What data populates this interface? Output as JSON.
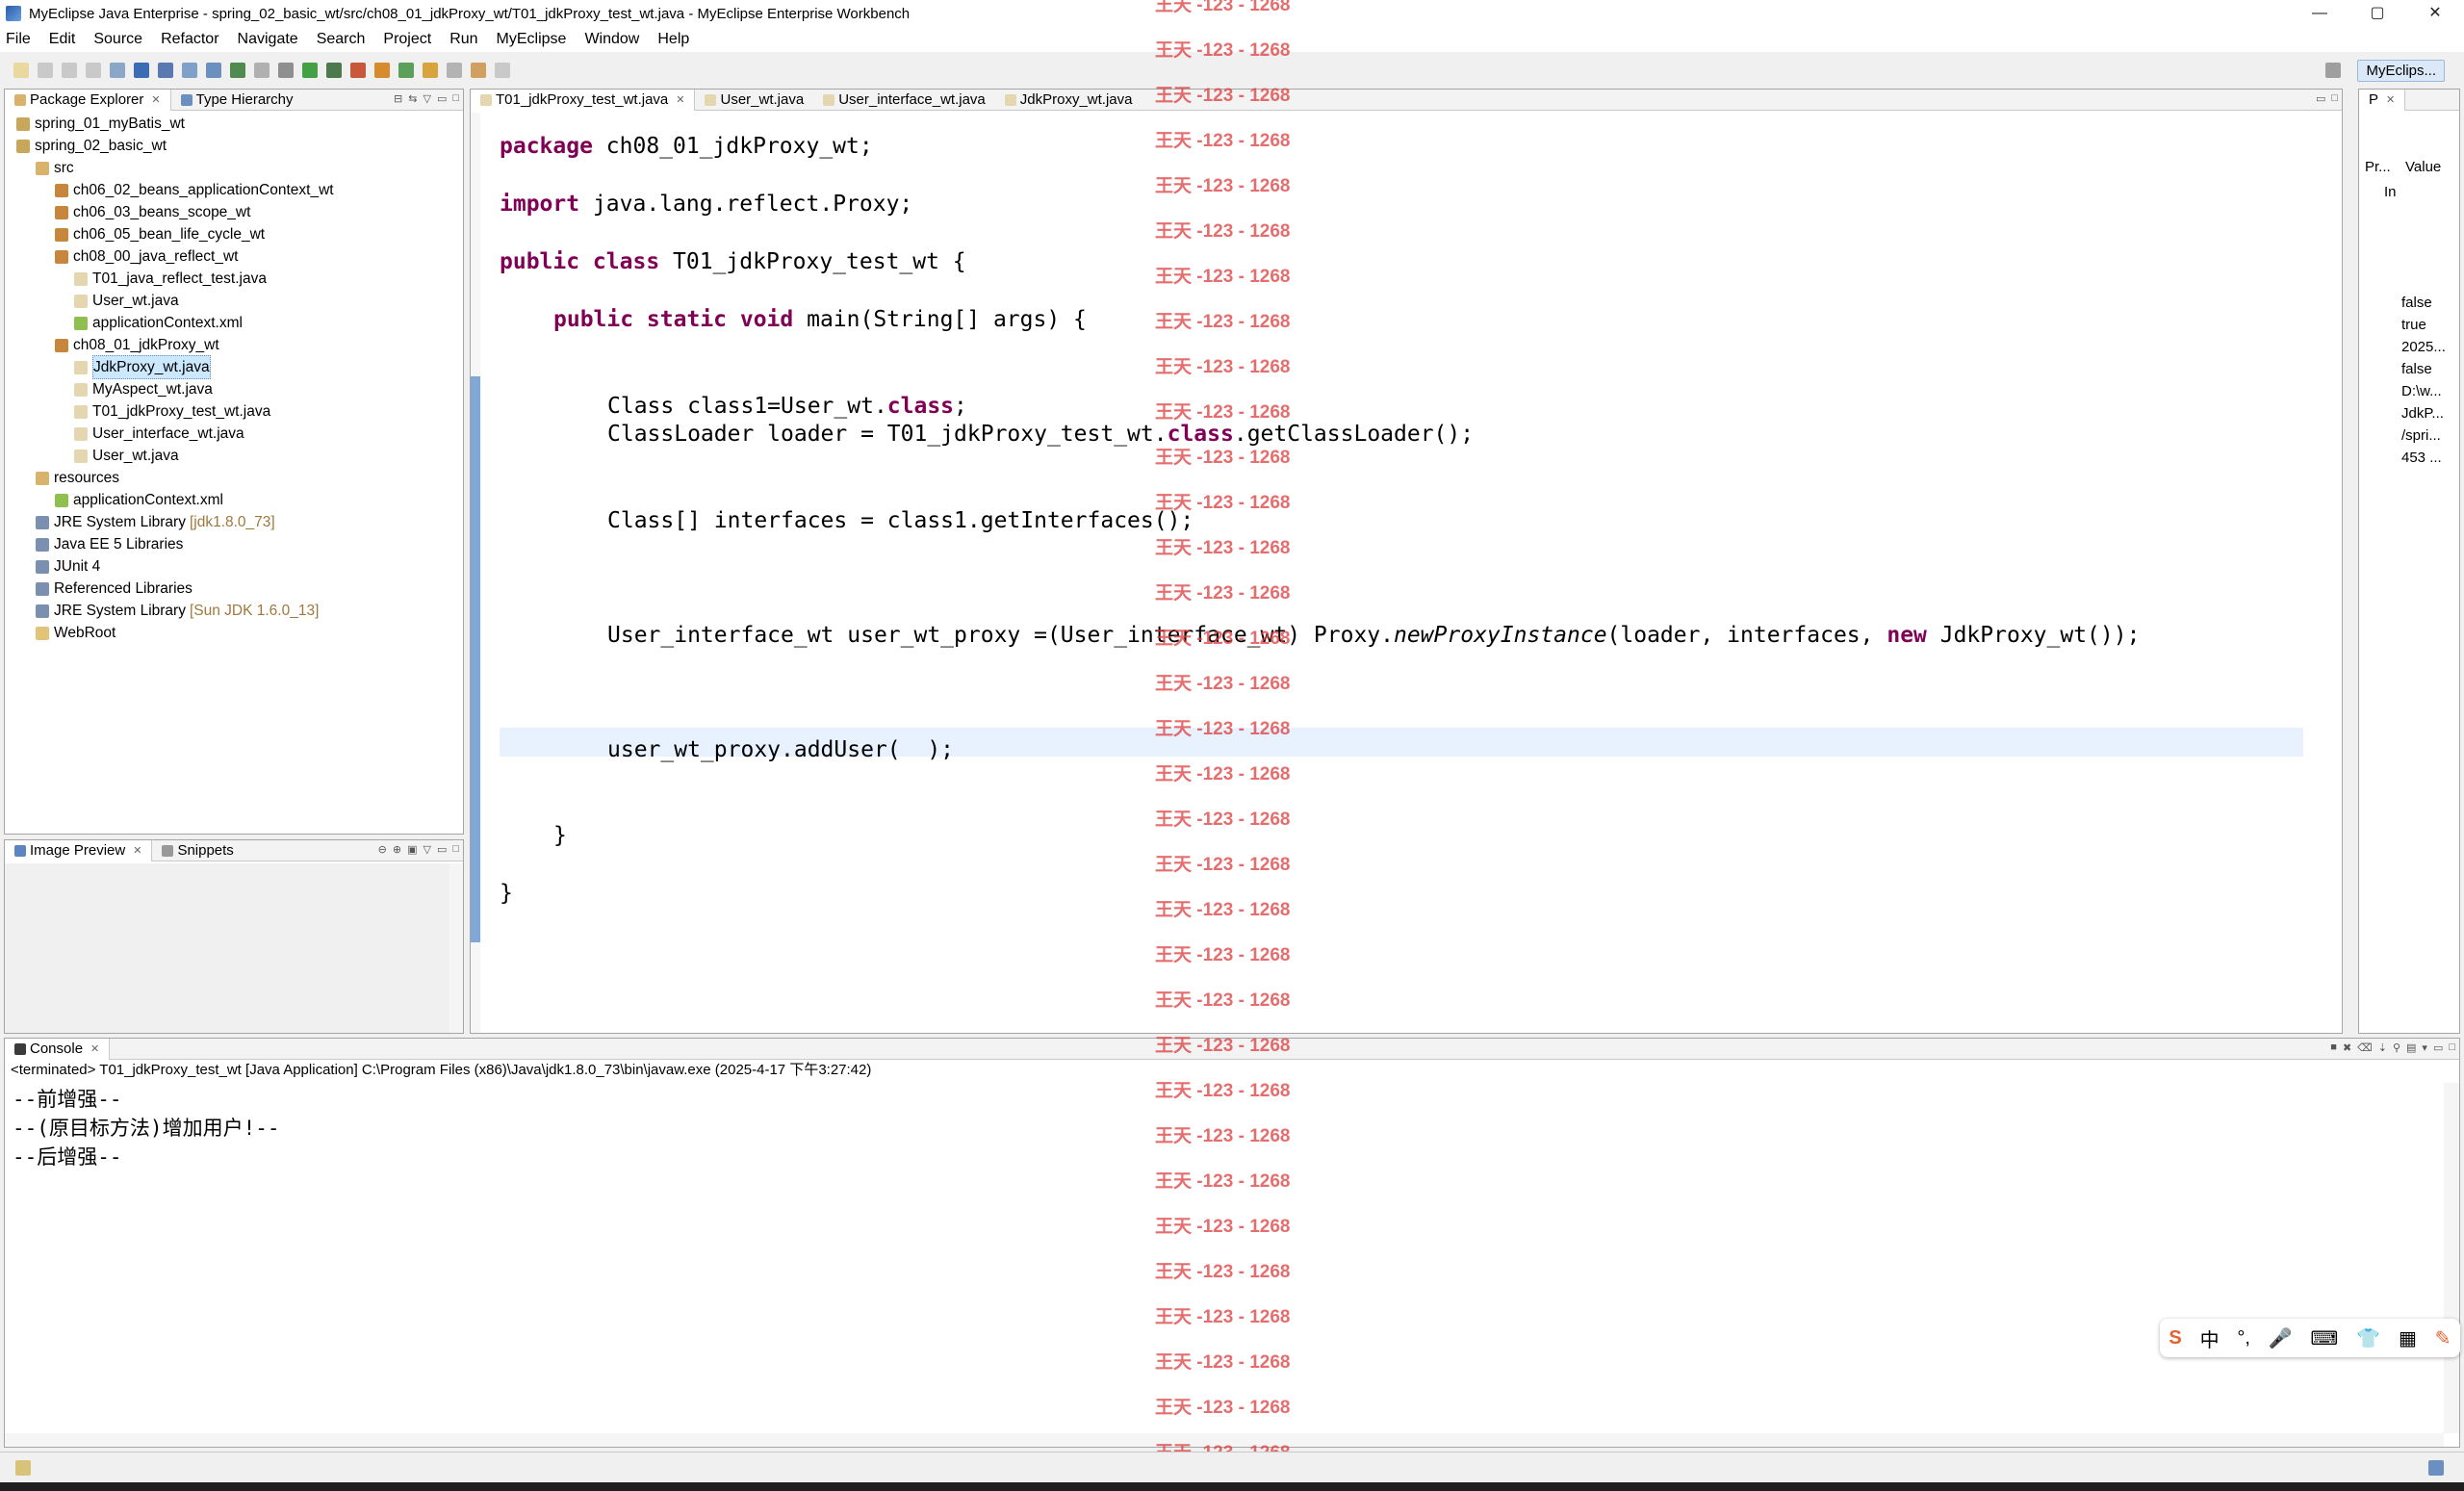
{
  "window": {
    "title": "MyEclipse Java Enterprise - spring_02_basic_wt/src/ch08_01_jdkProxy_wt/T01_jdkProxy_test_wt.java - MyEclipse Enterprise Workbench",
    "minimize": "—",
    "maximize": "▢",
    "close": "✕"
  },
  "menu": [
    "File",
    "Edit",
    "Source",
    "Refactor",
    "Navigate",
    "Search",
    "Project",
    "Run",
    "MyEclipse",
    "Window",
    "Help"
  ],
  "perspective": {
    "label": "MyEclips..."
  },
  "package_explorer": {
    "tabs": [
      "Package Explorer",
      "Type Hierarchy"
    ],
    "tree": [
      {
        "label": "spring_01_myBatis_wt",
        "indent": 0,
        "icon": "project-icon"
      },
      {
        "label": "spring_02_basic_wt",
        "indent": 0,
        "icon": "project-icon"
      },
      {
        "label": "src",
        "indent": 1,
        "icon": "source-folder-icon"
      },
      {
        "label": "ch06_02_beans_applicationContext_wt",
        "indent": 2,
        "icon": "package-icon"
      },
      {
        "label": "ch06_03_beans_scope_wt",
        "indent": 2,
        "icon": "package-icon"
      },
      {
        "label": "ch06_05_bean_life_cycle_wt",
        "indent": 2,
        "icon": "package-icon"
      },
      {
        "label": "ch08_00_java_reflect_wt",
        "indent": 2,
        "icon": "package-icon"
      },
      {
        "label": "T01_java_reflect_test.java",
        "indent": 3,
        "icon": "java-file-icon"
      },
      {
        "label": "User_wt.java",
        "indent": 3,
        "icon": "java-file-icon"
      },
      {
        "label": "applicationContext.xml",
        "indent": 3,
        "icon": "xml-file-icon"
      },
      {
        "label": "ch08_01_jdkProxy_wt",
        "indent": 2,
        "icon": "package-icon"
      },
      {
        "label": "JdkProxy_wt.java",
        "indent": 3,
        "icon": "java-file-icon",
        "selected": true
      },
      {
        "label": "MyAspect_wt.java",
        "indent": 3,
        "icon": "java-file-icon"
      },
      {
        "label": "T01_jdkProxy_test_wt.java",
        "indent": 3,
        "icon": "java-file-icon"
      },
      {
        "label": "User_interface_wt.java",
        "indent": 3,
        "icon": "java-file-icon"
      },
      {
        "label": "User_wt.java",
        "indent": 3,
        "icon": "java-file-icon"
      },
      {
        "label": "resources",
        "indent": 1,
        "icon": "source-folder-icon"
      },
      {
        "label": "applicationContext.xml",
        "indent": 2,
        "icon": "xml-file-icon"
      },
      {
        "label": "JRE System Library",
        "indent": 1,
        "icon": "library-icon",
        "deco": "[jdk1.8.0_73]"
      },
      {
        "label": "Java EE 5 Libraries",
        "indent": 1,
        "icon": "library-icon"
      },
      {
        "label": "JUnit 4",
        "indent": 1,
        "icon": "library-icon"
      },
      {
        "label": "Referenced Libraries",
        "indent": 1,
        "icon": "library-icon"
      },
      {
        "label": "JRE System Library",
        "indent": 1,
        "icon": "library-icon",
        "deco": "[Sun JDK 1.6.0_13]"
      },
      {
        "label": "WebRoot",
        "indent": 1,
        "icon": "folder-icon"
      }
    ]
  },
  "image_preview": {
    "tabs": [
      "Image Preview",
      "Snippets"
    ]
  },
  "editor": {
    "tabs": [
      "T01_jdkProxy_test_wt.java",
      "User_wt.java",
      "User_interface_wt.java",
      "JdkProxy_wt.java"
    ],
    "lines": {
      "l1_kw": "package",
      "l1_rest": " ch08_01_jdkProxy_wt;",
      "l2_kw": "import",
      "l2_rest": " java.lang.reflect.Proxy;",
      "l3_kw": "public class",
      "l3_rest": " T01_jdkProxy_test_wt {",
      "l4_kw": "public static void",
      "l4_rest": " main(String[] args) {",
      "l5_a": "Class class1=User_wt.",
      "l5_kw": "class",
      "l5_b": ";",
      "l6_a": "ClassLoader loader = T01_jdkProxy_test_wt.",
      "l6_kw": "class",
      "l6_b": ".getClassLoader();",
      "l7": "Class[] interfaces = class1.getInterfaces();",
      "l8_a": "User_interface_wt user_wt_proxy =(User_interface_wt) Proxy.",
      "l8_it": "newProxyInstance",
      "l8_b": "(loader, interfaces, ",
      "l8_kw": "new",
      "l8_c": " JdkProxy_wt());",
      "l9": "user_wt_proxy.addUser(  );",
      "l10": "}",
      "l11": "}"
    }
  },
  "properties": {
    "tab": "P",
    "col_property": "Pr...",
    "col_value": "Value",
    "group": "In",
    "values": [
      "false",
      "true",
      "2025...",
      "false",
      "D:\\w...",
      "JdkP...",
      "/spri...",
      "453 ..."
    ]
  },
  "console": {
    "tab": "Console",
    "info": "<terminated> T01_jdkProxy_test_wt [Java Application] C:\\Program Files (x86)\\Java\\jdk1.8.0_73\\bin\\javaw.exe (2025-4-17 下午3:27:42)",
    "output": [
      "--前增强--",
      "--(原目标方法)增加用户!--",
      "--后增强--"
    ]
  },
  "watermark": {
    "text": "王天 -123 - 1268"
  },
  "ime": {
    "items": [
      "S",
      "中",
      "°,",
      "🎤",
      "⌨",
      "👕",
      "▦",
      "✎"
    ]
  },
  "colors": {
    "keyword": "#7f0055",
    "watermark": "#dc3c3c",
    "selection": "#cce8ff",
    "current_line": "#e8f2fe"
  }
}
